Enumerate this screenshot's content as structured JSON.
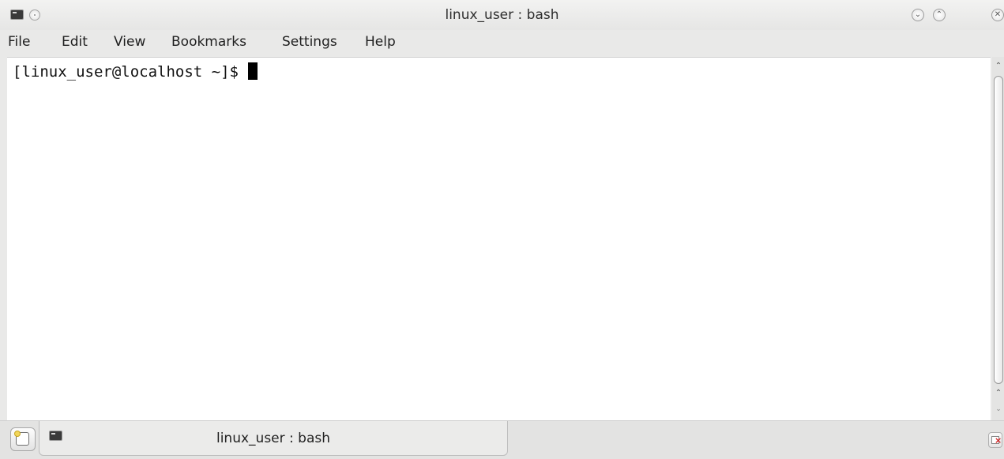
{
  "window": {
    "title": "linux_user : bash",
    "icons": {
      "app": "terminal-icon",
      "sticky": "sticky-icon",
      "minimize": "chevron-down-icon",
      "maximize": "chevron-up-icon",
      "close": "close-icon"
    }
  },
  "menubar": {
    "items": [
      "File",
      "Edit",
      "View",
      "Bookmarks",
      "Settings",
      "Help"
    ]
  },
  "terminal": {
    "prompt": "[linux_user@localhost ~]$ "
  },
  "tabs": {
    "active_label": "linux_user : bash",
    "icons": {
      "new_tab": "new-tab-icon",
      "tab": "terminal-icon",
      "close_tab": "close-tab-icon"
    }
  }
}
